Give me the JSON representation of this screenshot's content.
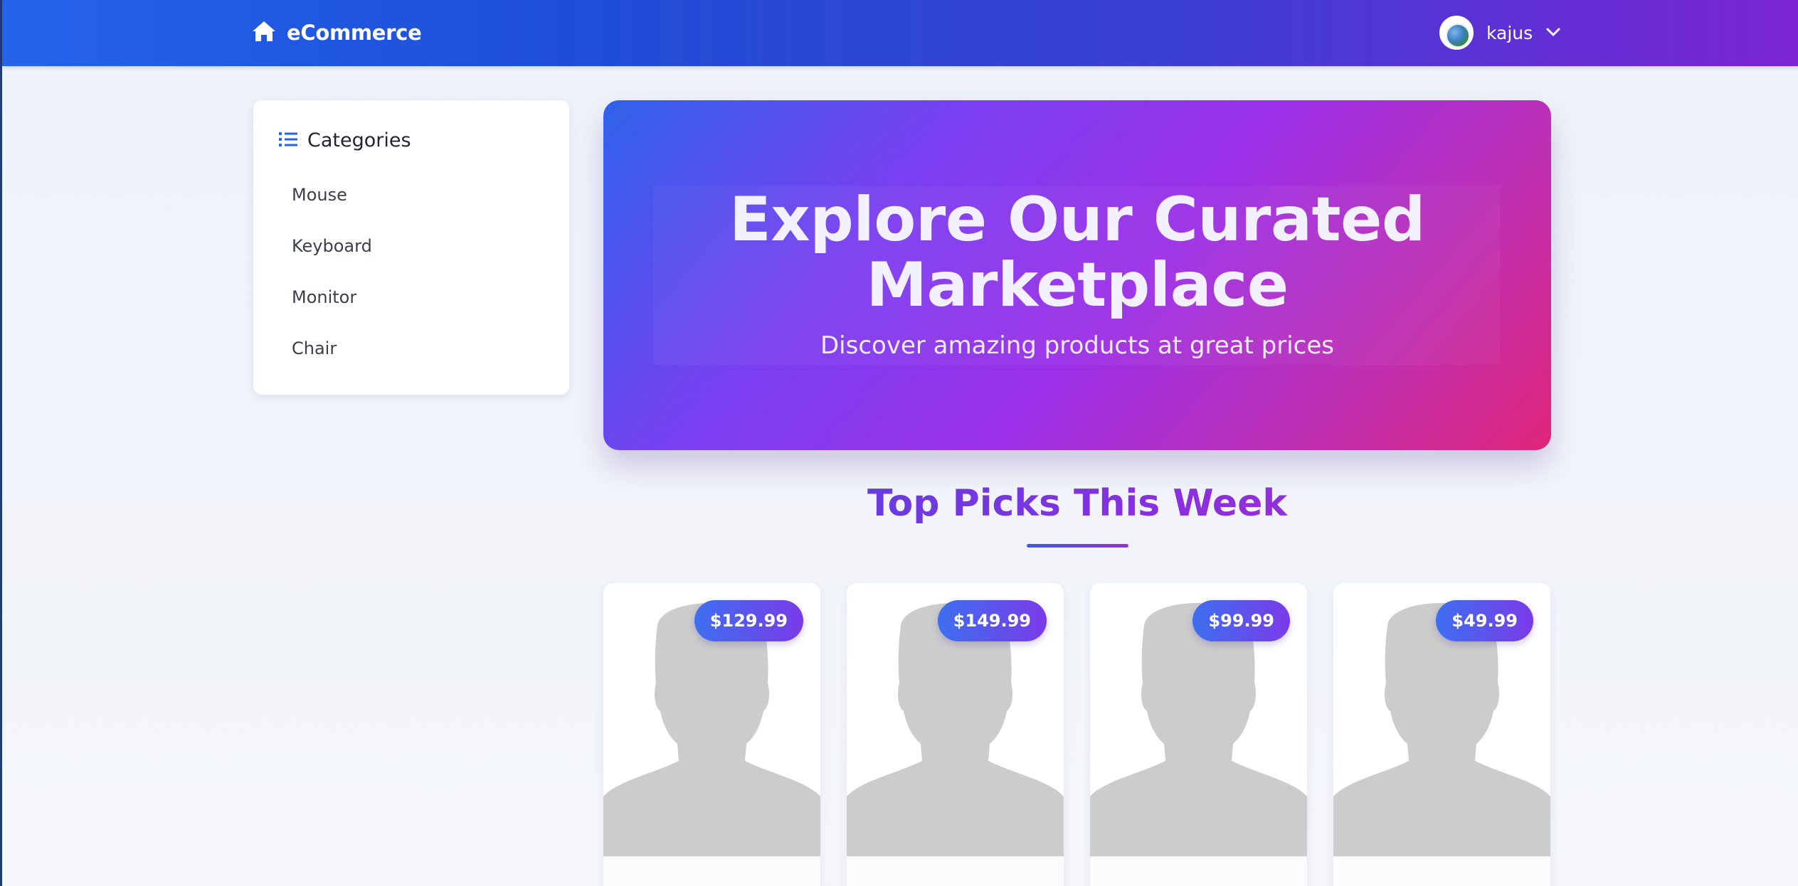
{
  "navbar": {
    "brand": "eCommerce",
    "brand_icon": "home-icon",
    "username": "kajus",
    "dropdown_icon": "chevron-down-icon"
  },
  "sidebar": {
    "title": "Categories",
    "title_icon": "list-icon",
    "items": [
      {
        "label": "Mouse"
      },
      {
        "label": "Keyboard"
      },
      {
        "label": "Monitor"
      },
      {
        "label": "Chair"
      }
    ]
  },
  "hero": {
    "title_line1": "Explore Our Curated",
    "title_line2": "Marketplace",
    "subtitle": "Discover amazing products at great prices"
  },
  "section": {
    "title": "Top Picks This Week"
  },
  "products": [
    {
      "price": "$129.99"
    },
    {
      "price": "$149.99"
    },
    {
      "price": "$99.99"
    },
    {
      "price": "$49.99"
    }
  ],
  "colors": {
    "accent_blue": "#2563eb",
    "accent_purple": "#9333ea",
    "accent_pink": "#db2777",
    "placeholder_gray": "#cccccc"
  }
}
